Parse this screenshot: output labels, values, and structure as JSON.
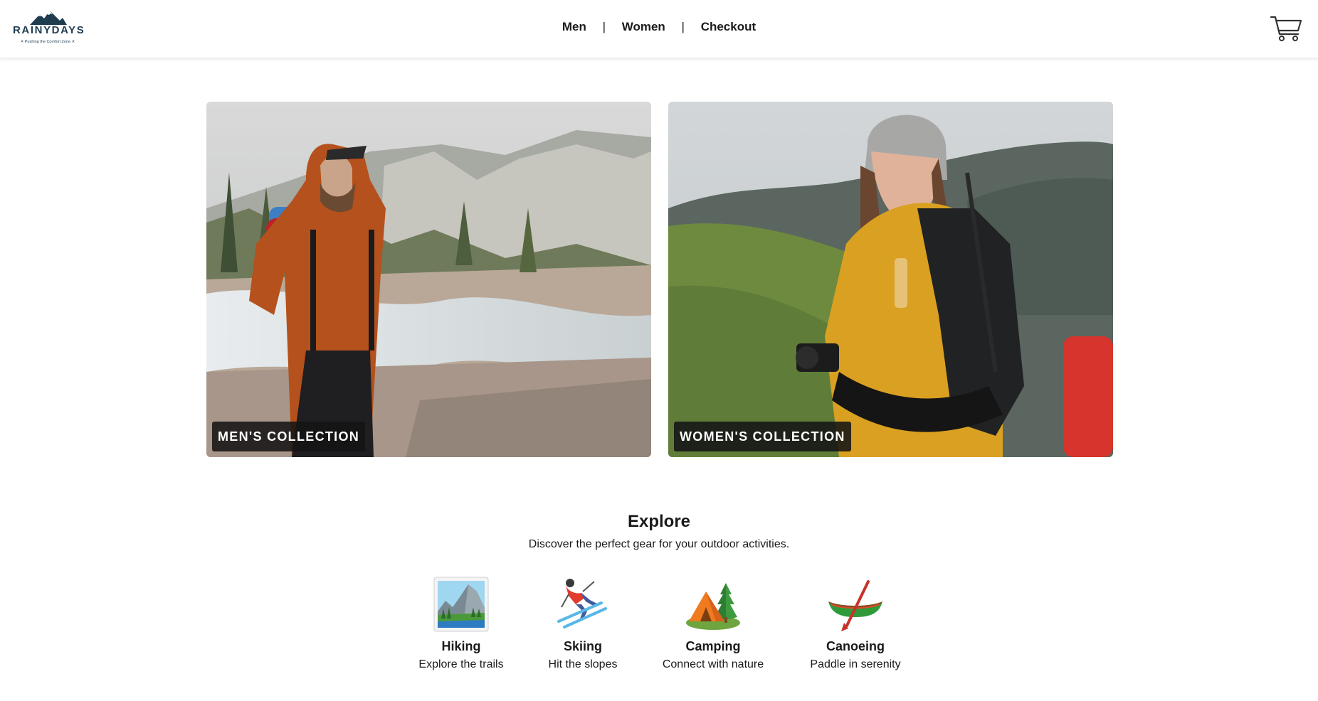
{
  "header": {
    "logo": {
      "wordmark": "RAINYDAYS",
      "tagline": "✕ Pushing the Comfort Zone ✕"
    },
    "nav": [
      {
        "label": "Men"
      },
      {
        "label": "Women"
      },
      {
        "label": "Checkout"
      }
    ],
    "nav_separator": "|",
    "cart_icon": "shopping-cart-icon"
  },
  "collections": [
    {
      "label": "MEN'S COLLECTION"
    },
    {
      "label": "WOMEN'S COLLECTION"
    }
  ],
  "explore": {
    "title": "Explore",
    "subtitle": "Discover the perfect gear for your outdoor activities.",
    "activities": [
      {
        "name": "Hiking",
        "description": "Explore the trails",
        "icon": "national-park-icon"
      },
      {
        "name": "Skiing",
        "description": "Hit the slopes",
        "icon": "skier-icon"
      },
      {
        "name": "Camping",
        "description": "Connect with nature",
        "icon": "tent-icon"
      },
      {
        "name": "Canoeing",
        "description": "Paddle in serenity",
        "icon": "canoe-icon"
      }
    ]
  },
  "colors": {
    "brand": "#1f3d4f",
    "label_bg": "#141414",
    "text": "#1a1a1a"
  }
}
